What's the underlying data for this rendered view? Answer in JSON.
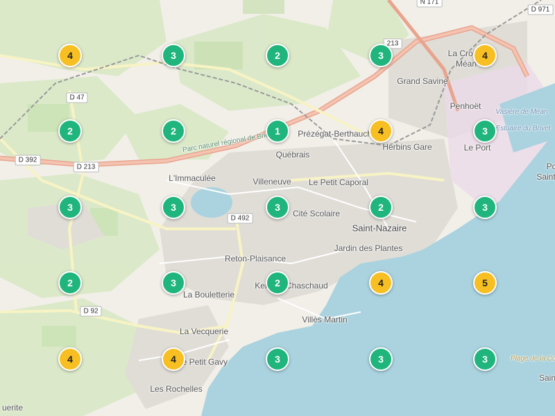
{
  "colors": {
    "land": "#f2efe9",
    "water": "#aad3df",
    "green": "#d7e8c4",
    "urban": "#e0ddd7",
    "marker_green": "#1fb57d",
    "marker_yellow": "#f7bf22"
  },
  "places": [
    {
      "name": "La Croix-",
      "size": "normal"
    },
    {
      "name": "Méan",
      "size": "normal"
    },
    {
      "name": "Grand Savine",
      "size": "normal"
    },
    {
      "name": "Penhoët",
      "size": "normal"
    },
    {
      "name": "Prézégat-Berthauche",
      "size": "normal"
    },
    {
      "name": "Herbins Gare",
      "size": "normal"
    },
    {
      "name": "Le Port",
      "size": "normal"
    },
    {
      "name": "Québrais",
      "size": "normal"
    },
    {
      "name": "L'Immaculée",
      "size": "normal"
    },
    {
      "name": "Villeneuve",
      "size": "normal"
    },
    {
      "name": "Le Petit Caporal",
      "size": "normal"
    },
    {
      "name": "Cité Scolaire",
      "size": "normal"
    },
    {
      "name": "Saint-Nazaire",
      "size": "big"
    },
    {
      "name": "Jardin des Plantes",
      "size": "normal"
    },
    {
      "name": "Reton-Plaisance",
      "size": "normal"
    },
    {
      "name": "La Bouletterie",
      "size": "normal"
    },
    {
      "name": "Kerlédé Chaschaud",
      "size": "normal"
    },
    {
      "name": "Villès Martin",
      "size": "normal"
    },
    {
      "name": "La Vecquerie",
      "size": "normal"
    },
    {
      "name": "Le Petit Gavy",
      "size": "normal"
    },
    {
      "name": "Les Rochelles",
      "size": "normal"
    },
    {
      "name": "uerite",
      "size": "normal"
    },
    {
      "name": "Po",
      "size": "normal"
    },
    {
      "name": "Saint",
      "size": "normal"
    },
    {
      "name": "Sain",
      "size": "normal"
    }
  ],
  "water_labels": [
    "Vasière de Méan",
    "Estuaire du Brivet"
  ],
  "beach_label": "Plage de la Courance",
  "park_label": "Parc naturel régional de Brière",
  "roads": [
    "N 171",
    "D 971",
    "D 47",
    "D 392",
    "D 213",
    "D 492",
    "D 92",
    "213"
  ],
  "clusters": [
    {
      "count": 4,
      "color": "yellow"
    },
    {
      "count": 3,
      "color": "green"
    },
    {
      "count": 2,
      "color": "green"
    },
    {
      "count": 3,
      "color": "green"
    },
    {
      "count": 4,
      "color": "yellow"
    },
    {
      "count": 2,
      "color": "green"
    },
    {
      "count": 2,
      "color": "green"
    },
    {
      "count": 1,
      "color": "green"
    },
    {
      "count": 4,
      "color": "yellow"
    },
    {
      "count": 3,
      "color": "green"
    },
    {
      "count": 3,
      "color": "green"
    },
    {
      "count": 3,
      "color": "green"
    },
    {
      "count": 3,
      "color": "green"
    },
    {
      "count": 2,
      "color": "green"
    },
    {
      "count": 3,
      "color": "green"
    },
    {
      "count": 2,
      "color": "green"
    },
    {
      "count": 3,
      "color": "green"
    },
    {
      "count": 2,
      "color": "green"
    },
    {
      "count": 4,
      "color": "yellow"
    },
    {
      "count": 5,
      "color": "yellow"
    },
    {
      "count": 4,
      "color": "yellow"
    },
    {
      "count": 4,
      "color": "yellow"
    },
    {
      "count": 3,
      "color": "green"
    },
    {
      "count": 3,
      "color": "green"
    },
    {
      "count": 3,
      "color": "green"
    }
  ]
}
